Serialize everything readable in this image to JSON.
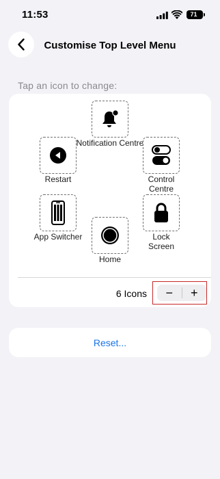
{
  "status_bar": {
    "time": "11:53",
    "battery": "71"
  },
  "header": {
    "title": "Customise Top Level Menu"
  },
  "section_header": "Tap an icon to change:",
  "menu": {
    "items": [
      {
        "id": "notification-centre",
        "label": "Notification Centre",
        "icon": "bell-icon"
      },
      {
        "id": "restart",
        "label": "Restart",
        "icon": "restart-icon"
      },
      {
        "id": "control-centre",
        "label": "Control Centre",
        "icon": "toggles-icon"
      },
      {
        "id": "app-switcher",
        "label": "App Switcher",
        "icon": "app-switcher-icon"
      },
      {
        "id": "lock-screen",
        "label": "Lock Screen",
        "icon": "padlock-icon"
      },
      {
        "id": "home",
        "label": "Home",
        "icon": "home-button-icon"
      }
    ],
    "count_label": "6 Icons",
    "decrease_label": "−",
    "increase_label": "+"
  },
  "reset_label": "Reset...",
  "colors": {
    "accent": "#1a73e8",
    "highlight": "#c62828",
    "background": "#f2f2f7"
  }
}
